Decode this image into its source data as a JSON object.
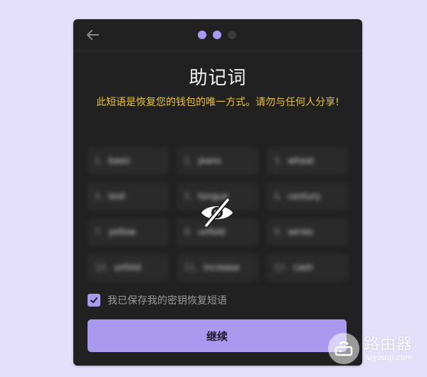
{
  "header": {
    "back_icon": "arrow-left-icon",
    "steps": [
      {
        "state": "active"
      },
      {
        "state": "active"
      },
      {
        "state": "inactive"
      }
    ]
  },
  "title": "助记词",
  "warning": "此短语是恢复您的钱包的唯一方式。请勿与任何人分享!",
  "seed_words": [
    {
      "index": "1.",
      "word": "basic"
    },
    {
      "index": "2.",
      "word": "jeans"
    },
    {
      "index": "3.",
      "word": "wheat"
    },
    {
      "index": "4.",
      "word": "text"
    },
    {
      "index": "5.",
      "word": "tongue"
    },
    {
      "index": "6.",
      "word": "century"
    },
    {
      "index": "7.",
      "word": "yellow"
    },
    {
      "index": "8.",
      "word": "unfold"
    },
    {
      "index": "9.",
      "word": "series"
    },
    {
      "index": "10.",
      "word": "unfold"
    },
    {
      "index": "11.",
      "word": "increase"
    },
    {
      "index": "12.",
      "word": "cash"
    }
  ],
  "reveal_icon": "eye-off-icon",
  "confirm": {
    "checked": true,
    "label": "我已保存我的密钥恢复短语"
  },
  "continue_label": "继续",
  "colors": {
    "accent": "#a99af0",
    "warning": "#e8c23a",
    "card_bg": "#222121",
    "page_bg": "#e4e0fb"
  },
  "watermark": {
    "text": "路由器",
    "sub": "luyouqi.com"
  }
}
